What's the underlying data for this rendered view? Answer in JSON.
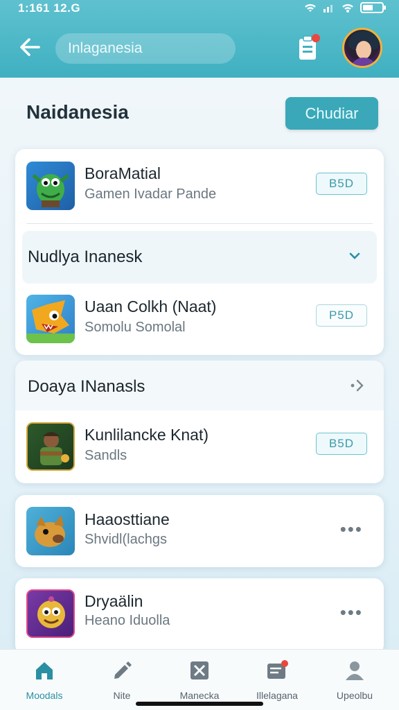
{
  "status_bar": {
    "time": "1:161 12.G"
  },
  "header": {
    "search_value": "Inlaganesia",
    "icons": [
      "back-arrow-icon",
      "clipboard-icon",
      "notification-dot",
      "avatar"
    ]
  },
  "page": {
    "title": "Naidanesia",
    "primary_button": "Chudiar"
  },
  "card1": {
    "item1": {
      "title": "BoraMatial",
      "subtitle": "Gamen Ivadar Pande",
      "badge": "B5D"
    },
    "section": {
      "label": "Nudlya Inanesk"
    },
    "item2": {
      "title": "Uaan Colkh (Naat)",
      "subtitle": "Somolu Somolal",
      "badge": "P5D"
    }
  },
  "card2": {
    "section": {
      "label": "Doaya INanasls"
    },
    "item1": {
      "title": "Kunlilancke Knat)",
      "subtitle": "Sandls",
      "badge": "B5D"
    }
  },
  "card3": {
    "title": "Haaosttiane",
    "subtitle": "Shvidl(lachgs",
    "more": "•••"
  },
  "card4": {
    "title": "Dryaälin",
    "subtitle": "Heano Iduolla",
    "more": "•••"
  },
  "bottom_nav": [
    {
      "label": "Moodals",
      "icon": "home-icon",
      "active": true
    },
    {
      "label": "Nite",
      "icon": "pencil-icon",
      "active": false
    },
    {
      "label": "Manecka",
      "icon": "image-box-icon",
      "active": false
    },
    {
      "label": "Illelagana",
      "icon": "mail-icon",
      "active": false
    },
    {
      "label": "Upeolbu",
      "icon": "person-icon",
      "active": false
    }
  ],
  "colors": {
    "accent": "#3fb0c1",
    "header": "#5fc1cf",
    "badge_text": "#3b9aab"
  }
}
